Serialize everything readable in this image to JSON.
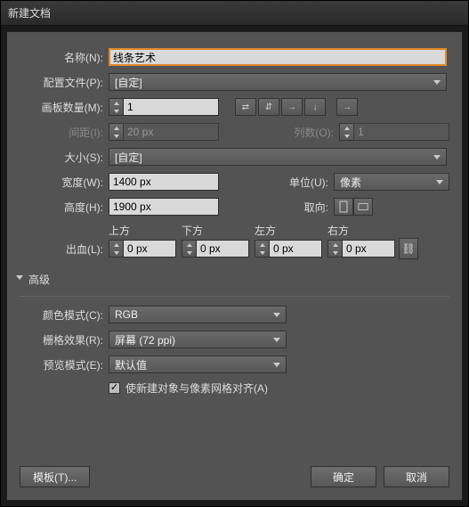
{
  "window": {
    "title": "新建文档"
  },
  "fields": {
    "name_label": "名称(N):",
    "name_value": "线条艺术",
    "profile_label": "配置文件(P):",
    "profile_value": "[自定]",
    "artboards_label": "画板数量(M):",
    "artboards_value": "1",
    "spacing_label": "间距(I):",
    "spacing_value": "20 px",
    "columns_label": "列数(O):",
    "columns_value": "1",
    "size_label": "大小(S):",
    "size_value": "[自定]",
    "width_label": "宽度(W):",
    "width_value": "1400 px",
    "units_label": "单位(U):",
    "units_value": "像素",
    "height_label": "高度(H):",
    "height_value": "1900 px",
    "orientation_label": "取向:",
    "bleed_label": "出血(L):",
    "bleed_top_label": "上方",
    "bleed_bottom_label": "下方",
    "bleed_left_label": "左方",
    "bleed_right_label": "右方",
    "bleed_top": "0 px",
    "bleed_bottom": "0 px",
    "bleed_left": "0 px",
    "bleed_right": "0 px"
  },
  "advanced": {
    "header": "高级",
    "color_mode_label": "颜色模式(C):",
    "color_mode_value": "RGB",
    "raster_label": "栅格效果(R):",
    "raster_value": "屏幕 (72 ppi)",
    "preview_label": "预览模式(E):",
    "preview_value": "默认值",
    "align_label": "使新建对象与像素网格对齐(A)"
  },
  "buttons": {
    "templates": "模板(T)...",
    "ok": "确定",
    "cancel": "取消"
  }
}
